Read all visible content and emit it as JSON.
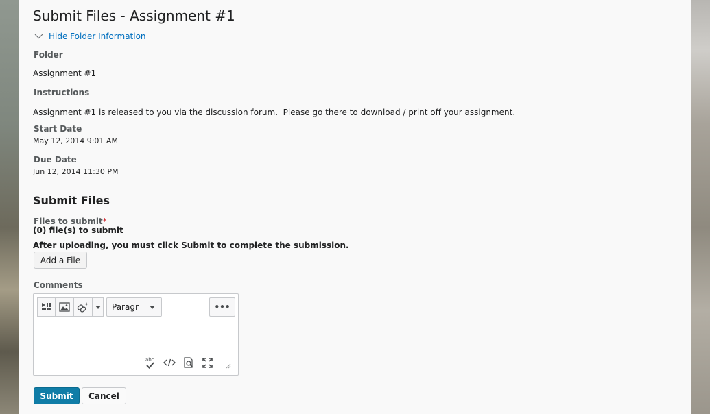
{
  "page": {
    "title": "Submit Files - Assignment #1",
    "toggle_label": "Hide Folder Information"
  },
  "folder_info": {
    "folder_label": "Folder",
    "folder_value": "Assignment #1",
    "instructions_label": "Instructions",
    "instructions_value": "Assignment #1 is released to you via the discussion forum.  Please go there to download / print off your assignment.",
    "start_date_label": "Start Date",
    "start_date_value": "May 12, 2014 9:01 AM",
    "due_date_label": "Due Date",
    "due_date_value": "Jun 12, 2014 11:30 PM"
  },
  "submit": {
    "heading": "Submit Files",
    "files_label": "Files to submit",
    "required_marker": "*",
    "file_count": "(0) file(s) to submit",
    "notice": "After uploading, you must click Submit to complete the submission.",
    "add_file_label": "Add a File",
    "comments_label": "Comments"
  },
  "editor": {
    "format_select": "Paragr",
    "spellcheck_text": "abc",
    "more_label": "•••"
  },
  "actions": {
    "submit_label": "Submit",
    "cancel_label": "Cancel"
  },
  "colors": {
    "link": "#006fbf",
    "primary_button": "#107da7",
    "required": "#cd2026"
  }
}
